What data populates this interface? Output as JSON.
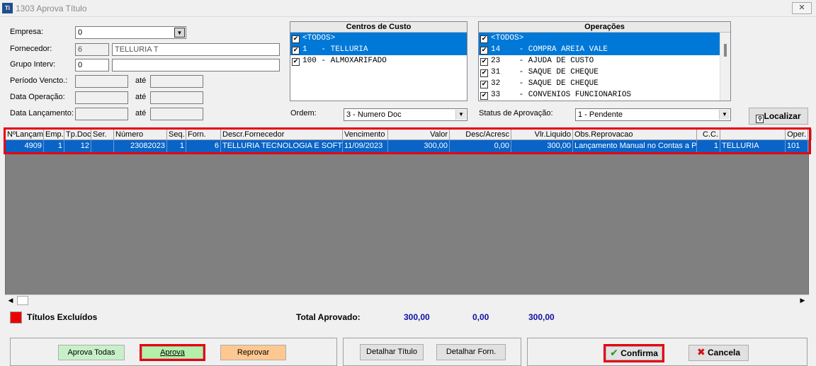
{
  "window": {
    "title": "1303 Aprova Título",
    "icon": "app-icon",
    "close_symbol": "✕"
  },
  "form": {
    "empresa_label": "Empresa:",
    "empresa_value": "0",
    "fornecedor_label": "Fornecedor:",
    "fornecedor_code": "6",
    "fornecedor_name": "TELLURIA T",
    "grupo_label": "Grupo Interv:",
    "grupo_code": "0",
    "grupo_name": "",
    "periodo_label": "Período Vencto.:",
    "operacao_label": "Data Operação:",
    "lancamento_label": "Data Lançamento:",
    "ate_label": "até",
    "ordem_label": "Ordem:",
    "ordem_value": "3 - Numero Doc",
    "status_label": "Status de Aprovação:",
    "status_value": "1 - Pendente",
    "localizar_label": "Localizar"
  },
  "centros": {
    "title": "Centros de Custo",
    "items": [
      {
        "text": "<TODOS>",
        "checked": true,
        "selected": true
      },
      {
        "text": "1   - TELLURIA",
        "checked": true,
        "selected": true
      },
      {
        "text": "100 - ALMOXARIFADO",
        "checked": true,
        "selected": false
      }
    ]
  },
  "operacoes": {
    "title": "Operações",
    "items": [
      {
        "text": "<TODOS>",
        "checked": true,
        "selected": true
      },
      {
        "text": "14    - COMPRA AREIA VALE",
        "checked": true,
        "selected": true
      },
      {
        "text": "23    - AJUDA DE CUSTO",
        "checked": true,
        "selected": false
      },
      {
        "text": "31    - SAQUE DE CHEQUE",
        "checked": true,
        "selected": false
      },
      {
        "text": "32    - SAQUE DE CHEQUE",
        "checked": true,
        "selected": false
      },
      {
        "text": "33    - CONVENIOS FUNCIONARIOS",
        "checked": true,
        "selected": false
      }
    ]
  },
  "grid": {
    "columns": [
      "NºLançam",
      "Emp.",
      "Tp.Doc",
      "Ser.",
      "Número",
      "Seq.",
      "Forn.",
      "Descr.Fornecedor",
      "Vencimento",
      "Valor",
      "Desc/Acresc",
      "Vlr.Liquido",
      "Obs.Reprovacao",
      "C.C.",
      "",
      "Oper."
    ],
    "rows": [
      [
        "4909",
        "1",
        "12",
        "",
        "23082023",
        "1",
        "6",
        "TELLURIA TECNOLOGIA E SOFTW",
        "11/09/2023",
        "300,00",
        "0,00",
        "300,00",
        "Lançamento Manual no Contas a Pag.",
        "1",
        "TELLURIA",
        "101"
      ]
    ]
  },
  "footer": {
    "excluidos_label": "Títulos Excluídos",
    "total_label": "Total Aprovado:",
    "total_valor": "300,00",
    "total_desc": "0,00",
    "total_liquido": "300,00"
  },
  "buttons": {
    "aprova_todas": "Aprova Todas",
    "aprova": "Aprova",
    "reprovar": "Reprovar",
    "detalhar_titulo": "Detalhar Título",
    "detalhar_forn": "Detalhar Forn.",
    "confirma": "Confirma",
    "cancela": "Cancela"
  },
  "colors": {
    "selection": "#0078d7",
    "grid_selection": "#0a64c8",
    "highlight": "#e8000b",
    "aprova_todas_bg": "#c8f0c8",
    "aprova_bg": "#b4f0a8",
    "reprovar_bg": "#ffc890",
    "totals": "#1010a0",
    "excluded_swatch": "#ee0000"
  }
}
